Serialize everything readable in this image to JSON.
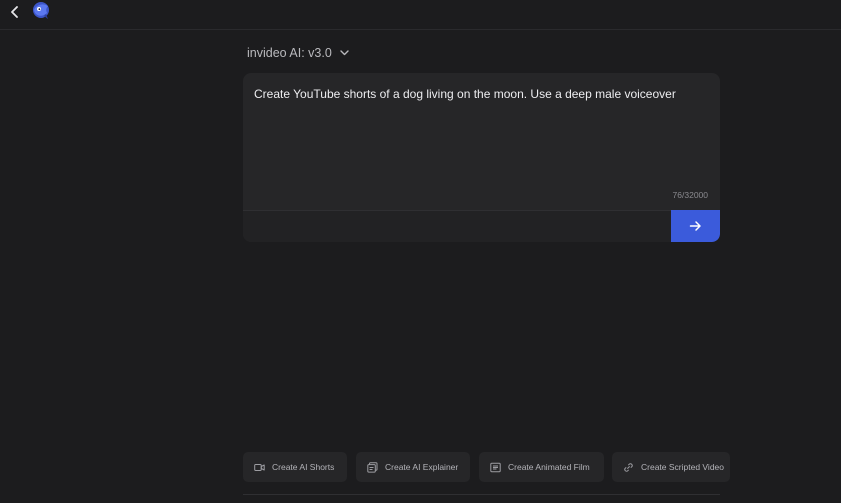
{
  "header": {
    "back_icon": "chevron-left-icon",
    "logo_icon": "invideo-logo-icon"
  },
  "version": {
    "label": "invideo AI: v3.0",
    "icon": "chevron-down-icon"
  },
  "prompt": {
    "text": "Create YouTube shorts of a dog living on the moon. Use a deep male voiceover",
    "char_count": "76/32000",
    "submit_icon": "arrow-right-icon",
    "submit_color": "#3b5bdb"
  },
  "suggestions": [
    {
      "label": "Create AI Shorts",
      "icon": "video-camera-icon"
    },
    {
      "label": "Create AI Explainer",
      "icon": "document-icon"
    },
    {
      "label": "Create Animated Film",
      "icon": "film-icon"
    },
    {
      "label": "Create Scripted Video",
      "icon": "link-icon"
    }
  ],
  "colors": {
    "background": "#1c1c1e",
    "card": "#262628",
    "accent": "#3b5bdb"
  }
}
